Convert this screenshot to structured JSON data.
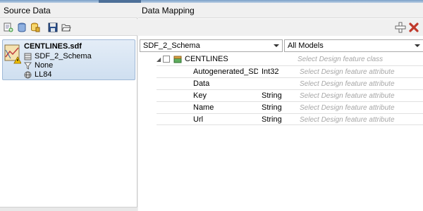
{
  "source_panel": {
    "title": "Source Data",
    "toolbar": [
      "add-source-icon",
      "add-database-icon",
      "add-yellow-database-icon",
      "save-icon",
      "open-folder-icon"
    ],
    "item": {
      "name": "CENTLINES.sdf",
      "schema": "SDF_2_Schema",
      "filter": "None",
      "coordsys": "LL84"
    }
  },
  "mapping_panel": {
    "title": "Data Mapping",
    "toolbar": [
      "add-icon",
      "delete-icon"
    ],
    "schema_select": "SDF_2_Schema",
    "models_select": "All Models",
    "feature_class": {
      "name": "CENTLINES",
      "hint": "Select Design feature class"
    },
    "attribute_hint": "Select Design feature attribute",
    "attributes": [
      {
        "name": "Autogenerated_SD...",
        "type": "Int32"
      },
      {
        "name": "Data",
        "type": ""
      },
      {
        "name": "Key",
        "type": "String"
      },
      {
        "name": "Name",
        "type": "String"
      },
      {
        "name": "Url",
        "type": "String"
      }
    ]
  },
  "colors": {
    "selection": "#cfdff0",
    "delete": "#c0392b",
    "hint_text": "#a6a6a6"
  }
}
